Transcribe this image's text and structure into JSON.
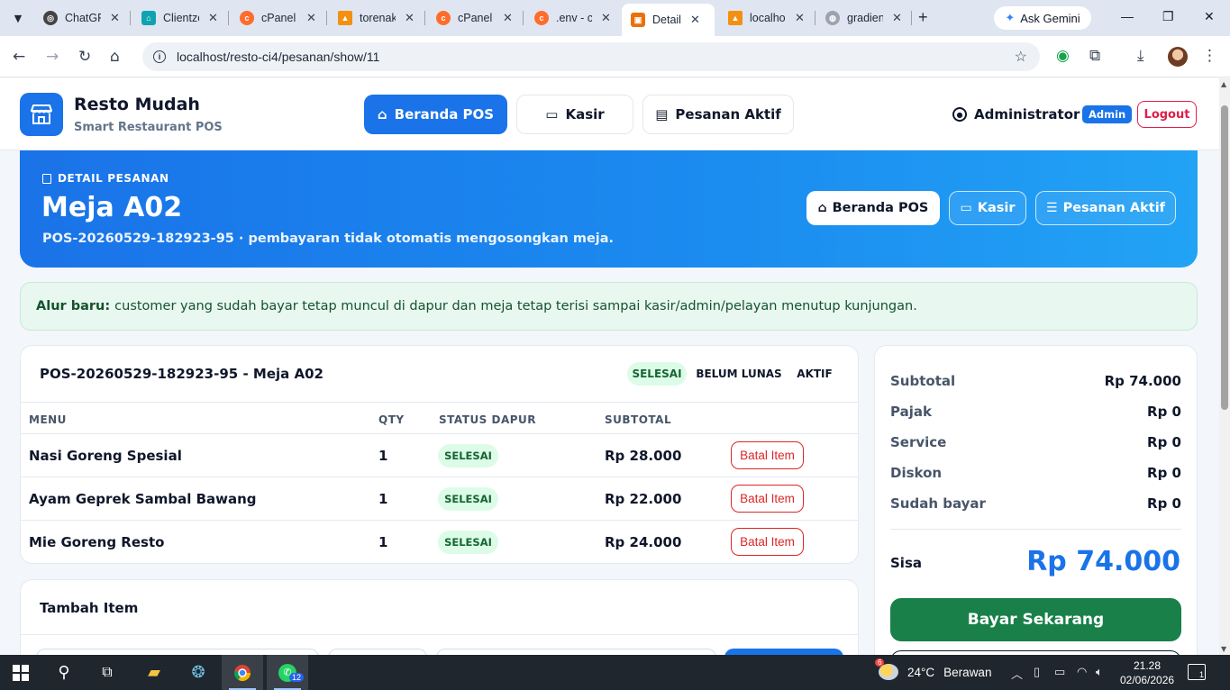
{
  "browser": {
    "tabs": [
      {
        "title": "ChatGPT",
        "favicon": "chatgpt-icon",
        "color": "#444444"
      },
      {
        "title": "Clientzone",
        "favicon": "clientzone-icon",
        "color": "#0fa3b1"
      },
      {
        "title": "cPanel",
        "favicon": "cpanel-icon",
        "color": "#ff6c2c"
      },
      {
        "title": "torenaku",
        "favicon": "phpmyadmin-icon",
        "color": "#f29111"
      },
      {
        "title": "cPanel",
        "favicon": "cpanel-icon",
        "color": "#ff6c2c"
      },
      {
        "title": ".env - cPanel",
        "favicon": "cpanel-icon",
        "color": "#ff6c2c"
      },
      {
        "title": "Detail Pesanan",
        "favicon": "app-icon",
        "color": "#e8710a"
      },
      {
        "title": "localhost",
        "favicon": "phpmyadmin-icon",
        "color": "#f29111"
      },
      {
        "title": "gradient",
        "favicon": "globe-icon",
        "color": "#6b7280"
      }
    ],
    "close_glyph": "✕",
    "new_tab_glyph": "+",
    "gemini_label": "Ask Gemini",
    "url": "localhost/resto-ci4/pesanan/show/11"
  },
  "app": {
    "brand_name": "Resto Mudah",
    "brand_sub": "Smart Restaurant POS",
    "nav": [
      {
        "label": "Beranda POS",
        "icon": "home-icon",
        "active": true
      },
      {
        "label": "Kasir",
        "icon": "cash-icon",
        "active": false
      },
      {
        "label": "Pesanan Aktif",
        "icon": "receipt-icon",
        "active": false
      }
    ],
    "user_name": "Administrator",
    "role_badge": "Admin",
    "logout_label": "Logout"
  },
  "hero": {
    "kicker": "DETAIL PESANAN",
    "title": "Meja A02",
    "subtitle": "POS-20260529-182923-95 · pembayaran tidak otomatis mengosongkan meja.",
    "buttons": [
      {
        "label": "Beranda POS",
        "icon": "home-icon"
      },
      {
        "label": "Kasir",
        "icon": "cash-icon"
      },
      {
        "label": "Pesanan Aktif",
        "icon": "list-icon"
      }
    ]
  },
  "alert": {
    "bold": "Alur baru:",
    "text": "customer yang sudah bayar tetap muncul di dapur dan meja tetap terisi sampai kasir/admin/pelayan menutup kunjungan."
  },
  "order": {
    "title": "POS-20260529-182923-95 - Meja A02",
    "badges": [
      "SELESAI",
      "BELUM LUNAS",
      "AKTIF"
    ],
    "columns": [
      "MENU",
      "QTY",
      "STATUS DAPUR",
      "SUBTOTAL"
    ],
    "items": [
      {
        "menu": "Nasi Goreng Spesial",
        "qty": "1",
        "status": "SELESAI",
        "subtotal": "Rp 28.000",
        "action": "Batal Item"
      },
      {
        "menu": "Ayam Geprek Sambal Bawang",
        "qty": "1",
        "status": "SELESAI",
        "subtotal": "Rp 22.000",
        "action": "Batal Item"
      },
      {
        "menu": "Mie Goreng Resto",
        "qty": "1",
        "status": "SELESAI",
        "subtotal": "Rp 24.000",
        "action": "Batal Item"
      }
    ]
  },
  "add_item": {
    "title": "Tambah Item"
  },
  "summary": {
    "rows": [
      {
        "label": "Subtotal",
        "value": "Rp 74.000"
      },
      {
        "label": "Pajak",
        "value": "Rp 0"
      },
      {
        "label": "Service",
        "value": "Rp 0"
      },
      {
        "label": "Diskon",
        "value": "Rp 0"
      },
      {
        "label": "Sudah bayar",
        "value": "Rp 0"
      }
    ],
    "sisa_label": "Sisa",
    "sisa_value": "Rp 74.000",
    "pay_label": "Bayar Sekarang"
  },
  "taskbar": {
    "weather_temp": "24°C",
    "weather_text": "Berawan",
    "weather_badge": "6",
    "whatsapp_badge": "12",
    "time": "21.28",
    "date": "02/06/2026",
    "notif_count": "1"
  }
}
